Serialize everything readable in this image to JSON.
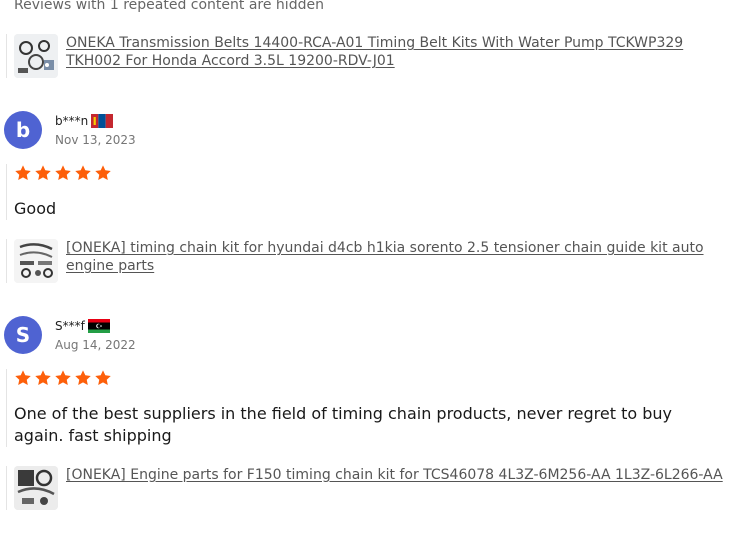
{
  "hidden_note": "Reviews with 1 repeated content are hidden",
  "colors": {
    "avatar_bg": "#4f63d2",
    "star": "#fd5f0a",
    "link": "#555555",
    "muted": "#767676"
  },
  "top_product": {
    "icon": "product-thumbnail-belt-kit",
    "title": "ONEKA Transmission Belts 14400-RCA-A01 Timing Belt Kits With Water Pump TCKWP329 TKH002 For Honda Accord 3.5L 19200-RDV-J01"
  },
  "reviews": [
    {
      "avatar_letter": "b",
      "name": "b***n",
      "flag": "mongolia-flag-icon",
      "date": "Nov 13, 2023",
      "rating": 5,
      "text": "Good",
      "product": {
        "icon": "product-thumbnail-chain-kit",
        "title": "[ONEKA] timing chain kit for hyundai d4cb h1kia sorento 2.5 tensioner chain guide kit auto engine parts"
      }
    },
    {
      "avatar_letter": "S",
      "name": "S***f",
      "flag": "libya-flag-icon",
      "date": "Aug 14, 2022",
      "rating": 5,
      "text": "One of the best suppliers in the field of timing chain products, never regret to buy again. fast shipping",
      "product": {
        "icon": "product-thumbnail-engine-parts",
        "title": "[ONEKA] Engine parts for F150 timing chain kit for TCS46078 4L3Z-6M256-AA 1L3Z-6L266-AA"
      }
    }
  ]
}
